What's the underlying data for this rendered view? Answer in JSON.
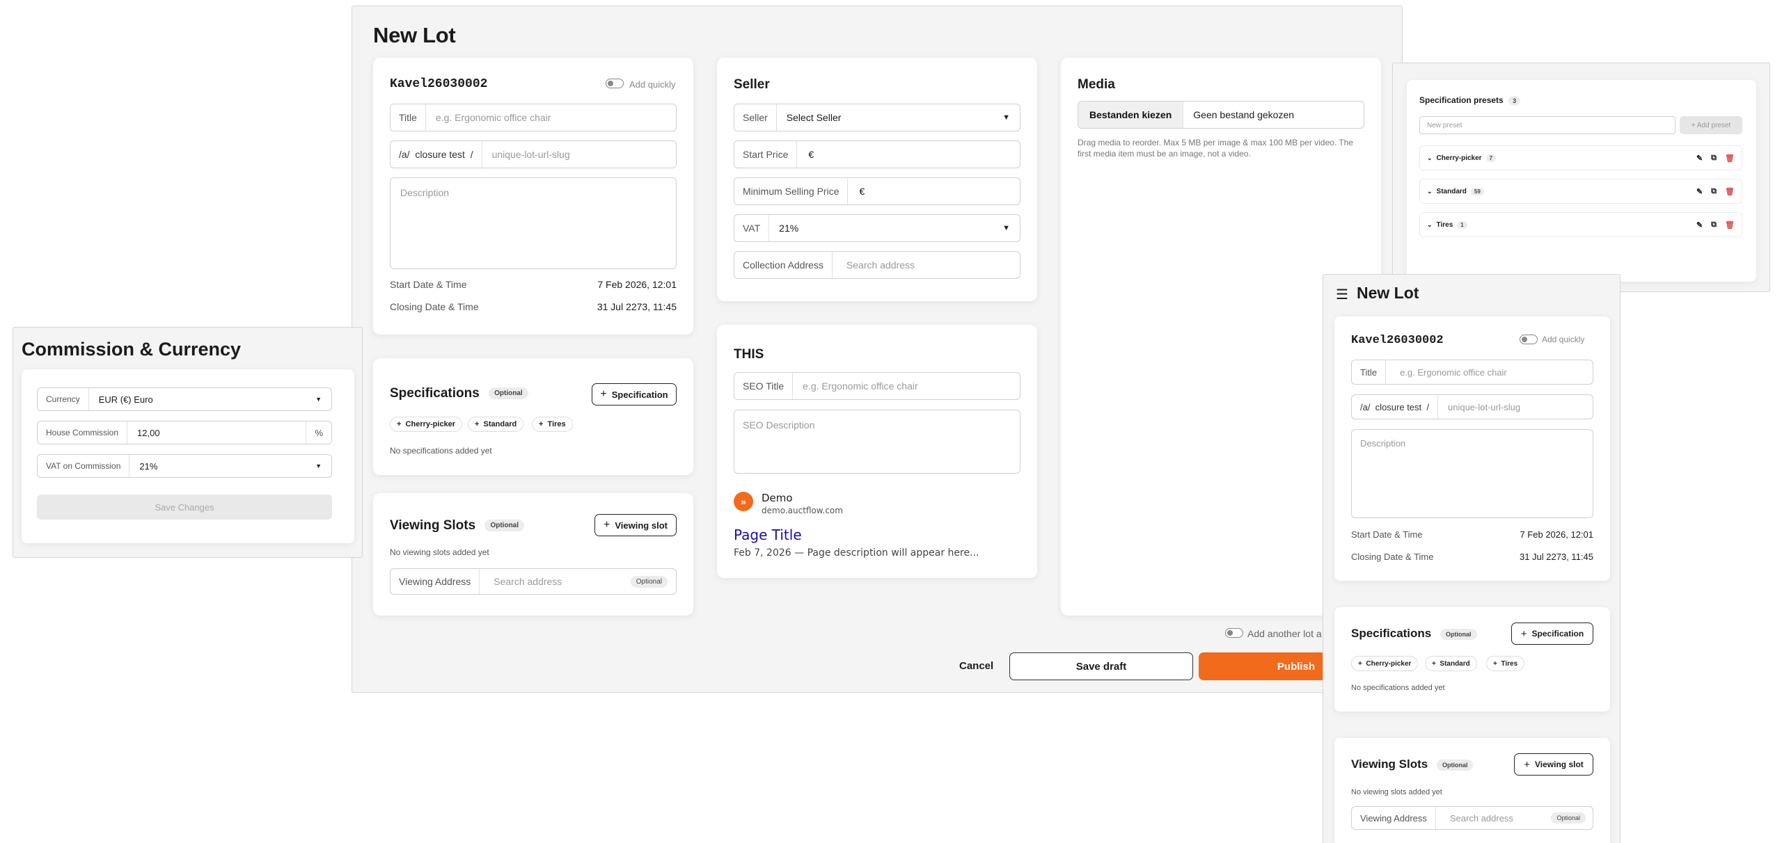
{
  "main": {
    "title": "New Lot",
    "lot": {
      "code": "Kavel26030002",
      "add_quickly": "Add quickly",
      "title_label": "Title",
      "title_placeholder": "e.g. Ergonomic office chair",
      "slug_prefix": "/a/  closure test  /",
      "slug_placeholder": "unique-lot-url-slug",
      "description_placeholder": "Description",
      "start_label": "Start Date & Time",
      "start_value": "7 Feb 2026, 12:01",
      "closing_label": "Closing Date & Time",
      "closing_value": "31 Jul 2273, 11:45"
    },
    "specifications": {
      "title": "Specifications",
      "badge": "Optional",
      "add_button": "Specification",
      "chips": [
        "Cherry-picker",
        "Standard",
        "Tires"
      ],
      "empty": "No specifications added yet"
    },
    "viewing": {
      "title": "Viewing Slots",
      "badge": "Optional",
      "add_button": "Viewing slot",
      "empty": "No viewing slots added yet",
      "address_label": "Viewing Address",
      "address_placeholder": "Search address",
      "address_badge": "Optional"
    },
    "seller": {
      "title": "Seller",
      "seller_label": "Seller",
      "seller_value": "Select Seller",
      "start_price_label": "Start Price",
      "currency_symbol": "€",
      "min_price_label": "Minimum Selling Price",
      "vat_label": "VAT",
      "vat_value": "21%",
      "collection_label": "Collection Address",
      "collection_placeholder": "Search address"
    },
    "seo": {
      "title": "THIS",
      "seo_title_label": "SEO Title",
      "seo_title_placeholder": "e.g. Ergonomic office chair",
      "seo_desc_placeholder": "SEO Description",
      "site_name": "Demo",
      "site_url": "demo.auctflow.com",
      "page_title": "Page Title",
      "snippet": "Feb 7, 2026 — Page description will appear here...",
      "link_color": "#1a0dab"
    },
    "media": {
      "title": "Media",
      "choose_button": "Bestanden kiezen",
      "no_file": "Geen bestand gekozen",
      "hint": "Drag media to reorder. Max 5 MB per image & max 100 MB per video. The first media item must be an image, not a video."
    },
    "footer": {
      "add_another": "Add another lot a",
      "cancel": "Cancel",
      "save_draft": "Save draft",
      "publish": "Publish",
      "accent": "#f26a1b"
    }
  },
  "commission": {
    "title": "Commission & Currency",
    "currency_label": "Currency",
    "currency_value": "EUR (€) Euro",
    "house_label": "House Commission",
    "house_value": "12,00",
    "house_unit": "%",
    "vat_label": "VAT on Commission",
    "vat_value": "21%",
    "save": "Save Changes"
  },
  "presets": {
    "title": "Specification presets",
    "count": "3",
    "input_placeholder": "New preset",
    "add_button": "+ Add preset",
    "items": [
      {
        "name": "Cherry-picker",
        "count": "7"
      },
      {
        "name": "Standard",
        "count": "59"
      },
      {
        "name": "Tires",
        "count": "1"
      }
    ]
  },
  "mobile": {
    "title": "New Lot",
    "code": "Kavel26030002",
    "add_quickly": "Add quickly",
    "title_label": "Title",
    "title_placeholder": "e.g. Ergonomic office chair",
    "slug_prefix": "/a/  closure test  /",
    "slug_placeholder": "unique-lot-url-slug",
    "description_placeholder": "Description",
    "start_label": "Start Date & Time",
    "start_value": "7 Feb 2026, 12:01",
    "closing_label": "Closing Date & Time",
    "closing_value": "31 Jul 2273, 11:45",
    "spec_title": "Specifications",
    "spec_badge": "Optional",
    "spec_button": "Specification",
    "chips": [
      "Cherry-picker",
      "Standard",
      "Tires"
    ],
    "spec_empty": "No specifications added yet",
    "viewing_title": "Viewing Slots",
    "viewing_badge": "Optional",
    "viewing_button": "Viewing slot",
    "viewing_empty": "No viewing slots added yet",
    "address_label": "Viewing Address",
    "address_placeholder": "Search address",
    "address_badge": "Optional"
  }
}
